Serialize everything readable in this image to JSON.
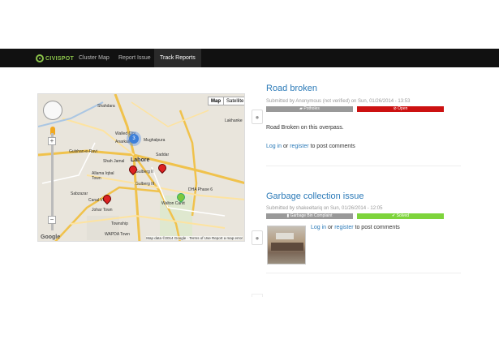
{
  "nav": {
    "logo_text": "CIVISPOT",
    "items": [
      {
        "label": "Cluster Map",
        "active": false
      },
      {
        "label": "Report Issue",
        "active": false
      },
      {
        "label": "Track Reports",
        "active": true
      }
    ]
  },
  "map": {
    "type_buttons": [
      "Map",
      "Satellite"
    ],
    "selected_type": "Map",
    "zoom_in": "+",
    "zoom_out": "−",
    "cluster_count": "3",
    "footer": "Map data ©2014 Google · Terms of Use   Report a map error",
    "google_label": "Google",
    "places": [
      {
        "name": "Shahdara"
      },
      {
        "name": "Walled City"
      },
      {
        "name": "Anarkali"
      },
      {
        "name": "Mughalpura"
      },
      {
        "name": "Lahore"
      },
      {
        "name": "Gulberg II"
      },
      {
        "name": "Gulberg III"
      },
      {
        "name": "Allama Iqbal Town"
      },
      {
        "name": "Johar Town"
      },
      {
        "name": "Township"
      },
      {
        "name": "Walton Cantt"
      },
      {
        "name": "DHA Phase 6"
      },
      {
        "name": "WAPDA Town"
      },
      {
        "name": "Canal View"
      },
      {
        "name": "Gulshan-e-Ravi"
      },
      {
        "name": "Sabzazar"
      },
      {
        "name": "Shah Jamal"
      },
      {
        "name": "Lakhanke"
      },
      {
        "name": "Saddar"
      }
    ]
  },
  "reports": [
    {
      "title": "Road broken",
      "meta": "Submitted by Anonymous (not verified) on Sun, 01/26/2014 - 13:53",
      "category": "Potholes",
      "category_color": "#999999",
      "status": "Open",
      "status_color": "#cc1111",
      "body": "Road Broken on this overpass.",
      "login_link": "Log in",
      "or_text": "or",
      "register_link": "register",
      "post_text": "to post comments"
    },
    {
      "title": "Garbage collection issue",
      "meta": "Submitted by shakeeltariq on Sun, 01/26/2014 - 12:05",
      "category": "Garbage Bin Complaint",
      "category_color": "#999999",
      "status": "Solved",
      "status_color": "#7ed43c",
      "body": "",
      "login_link": "Log in",
      "or_text": "or",
      "register_link": "register",
      "post_text": "to post comments"
    }
  ]
}
